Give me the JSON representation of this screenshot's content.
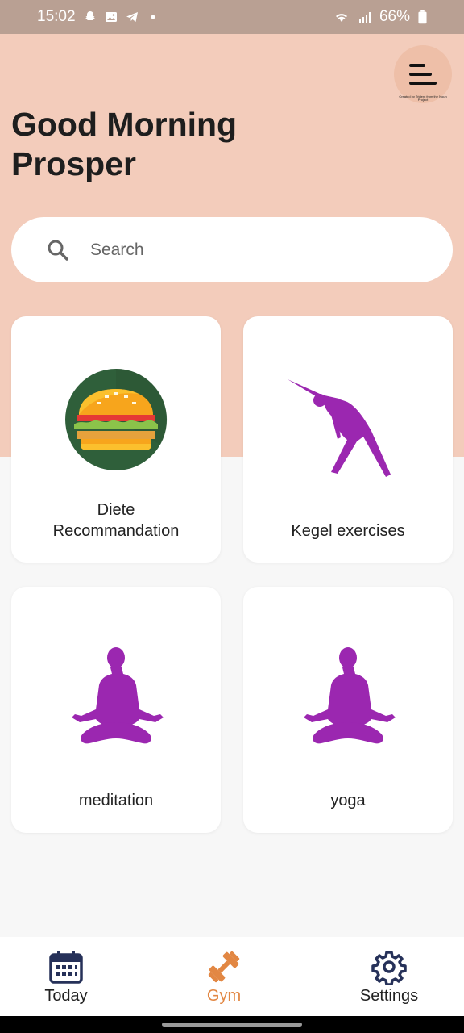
{
  "status_bar": {
    "time": "15:02",
    "battery": "66%",
    "icons": [
      "snapchat-icon",
      "gallery-icon",
      "telegram-icon",
      "dot-icon",
      "wifi-icon",
      "signal-icon",
      "battery-icon"
    ]
  },
  "header": {
    "greeting": "Good Morning Prosper",
    "menu_icon": "menu-icon",
    "menu_caption": "Created by Trident from the Noun Project",
    "background": "#f3ccbb"
  },
  "search": {
    "placeholder": "Search",
    "icon": "search-icon"
  },
  "cards": [
    {
      "label_line1": "Diete",
      "label_line2": "Recommandation",
      "icon": "burger-icon"
    },
    {
      "label": "Kegel exercises",
      "icon": "stretching-figure-icon"
    },
    {
      "label": "meditation",
      "icon": "meditation-figure-icon"
    },
    {
      "label": "yoga",
      "icon": "yoga-figure-icon"
    }
  ],
  "bottom_nav": {
    "items": [
      {
        "label": "Today",
        "icon": "calendar-icon",
        "active": false
      },
      {
        "label": "Gym",
        "icon": "dumbbell-icon",
        "active": true
      },
      {
        "label": "Settings",
        "icon": "gear-icon",
        "active": false
      }
    ],
    "active_color": "#e28743"
  },
  "colors": {
    "accent": "#e28743",
    "figure_purple": "#9b27b0",
    "status_bar": "#b9a093"
  }
}
